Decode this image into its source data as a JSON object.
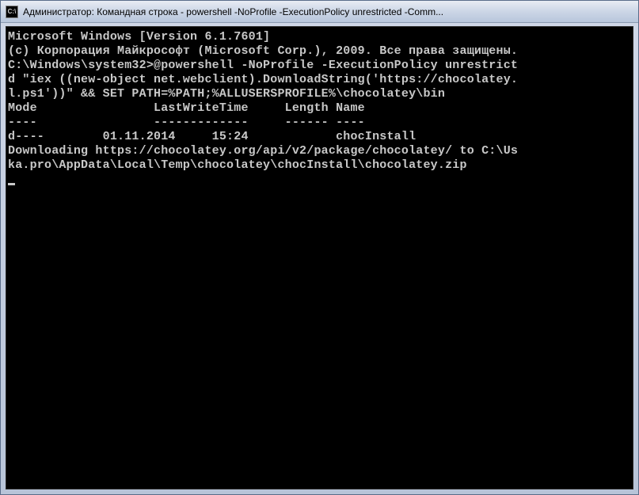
{
  "titlebar": {
    "icon_label": "C:\\",
    "text": "Администратор: Командная строка - powershell  -NoProfile -ExecutionPolicy unrestricted -Comm..."
  },
  "terminal": {
    "lines": [
      "Microsoft Windows [Version 6.1.7601]",
      "(c) Корпорация Майкрософт (Microsoft Corp.), 2009. Все права защищены.",
      "",
      "C:\\Windows\\system32>@powershell -NoProfile -ExecutionPolicy unrestrict",
      "d \"iex ((new-object net.webclient).DownloadString('https://chocolatey.",
      "l.ps1'))\" && SET PATH=%PATH;%ALLUSERSPROFILE%\\chocolatey\\bin",
      "",
      "Mode                LastWriteTime     Length Name",
      "----                -------------     ------ ----",
      "d----        01.11.2014     15:24            chocInstall",
      "Downloading https://chocolatey.org/api/v2/package/chocolatey/ to C:\\Us",
      "ka.pro\\AppData\\Local\\Temp\\chocolatey\\chocInstall\\chocolatey.zip"
    ]
  }
}
